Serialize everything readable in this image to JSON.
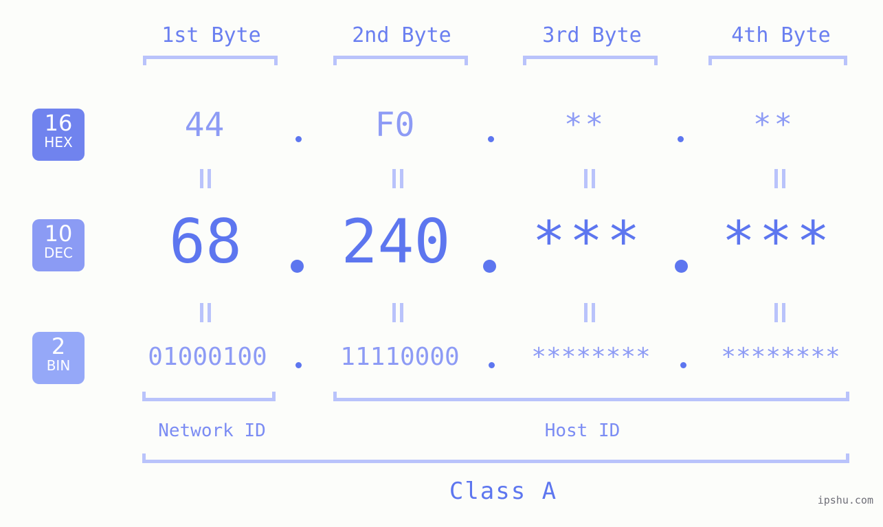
{
  "page": {
    "background_color": "#fcfdfa",
    "accent_color": "#5d76ef",
    "accent_light_color": "#8d9bf5",
    "bracket_color": "#b9c3fb",
    "watermark": "ipshu.com"
  },
  "byte_headers": [
    {
      "label": "1st Byte"
    },
    {
      "label": "2nd Byte"
    },
    {
      "label": "3rd Byte"
    },
    {
      "label": "4th Byte"
    }
  ],
  "bases": [
    {
      "number": "16",
      "name": "HEX",
      "badge_color": "#7083ee"
    },
    {
      "number": "10",
      "name": "DEC",
      "badge_color": "#8b9bf4"
    },
    {
      "number": "2",
      "name": "BIN",
      "badge_color": "#95a8f8"
    }
  ],
  "rows": {
    "hex": {
      "base_number": "16",
      "base_name": "HEX",
      "values": [
        "44",
        "F0",
        "**",
        "**"
      ],
      "separator": "."
    },
    "dec": {
      "base_number": "10",
      "base_name": "DEC",
      "values": [
        "68",
        "240",
        "***",
        "***"
      ],
      "separator": "."
    },
    "bin": {
      "base_number": "2",
      "base_name": "BIN",
      "values": [
        "01000100",
        "11110000",
        "********",
        "********"
      ],
      "separator": "."
    }
  },
  "equals_marks": {
    "symbol": "=",
    "count_per_row_gap": 4
  },
  "sections": [
    {
      "label": "Network ID"
    },
    {
      "label": "Host ID"
    }
  ],
  "class": {
    "label": "Class A"
  }
}
